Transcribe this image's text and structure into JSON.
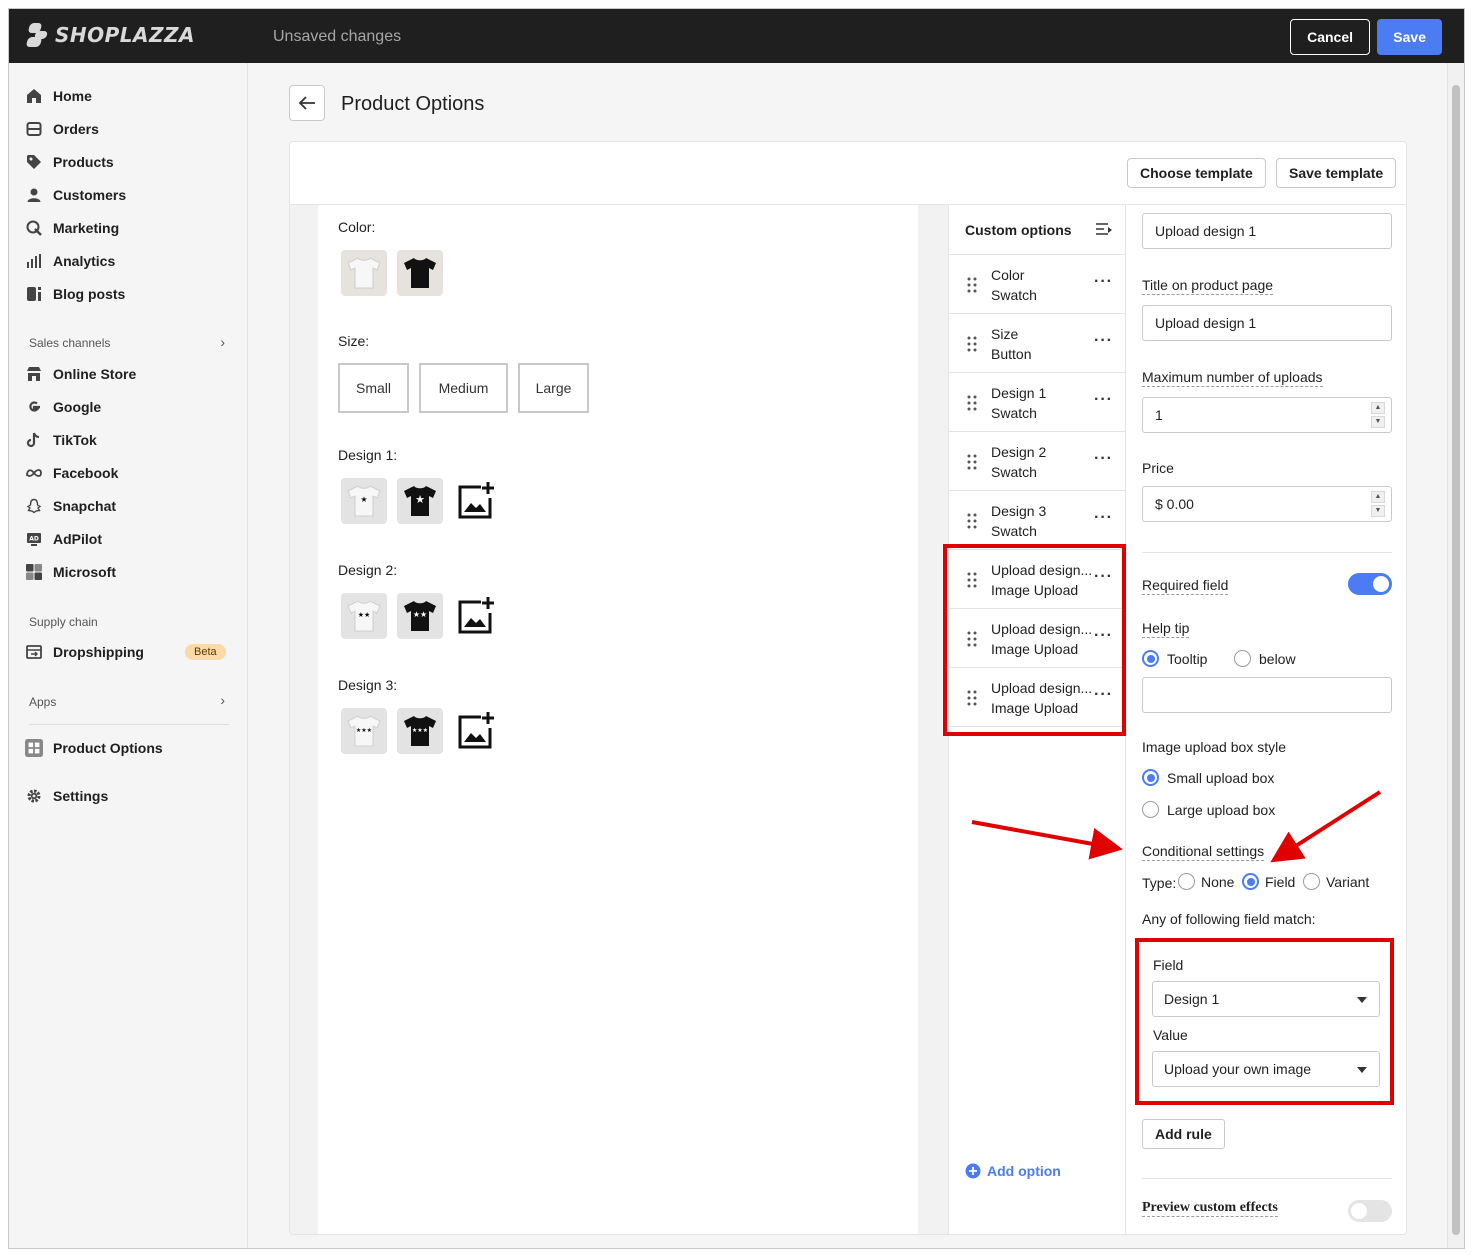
{
  "topbar": {
    "logo_text": "SHOPLAZZA",
    "status": "Unsaved changes",
    "cancel_label": "Cancel",
    "save_label": "Save",
    "accent": "#4c7cf3"
  },
  "sidebar": {
    "main_items": [
      {
        "label": "Home",
        "icon": "home-icon"
      },
      {
        "label": "Orders",
        "icon": "orders-icon"
      },
      {
        "label": "Products",
        "icon": "tag-icon"
      },
      {
        "label": "Customers",
        "icon": "person-icon"
      },
      {
        "label": "Marketing",
        "icon": "megaphone-icon"
      },
      {
        "label": "Analytics",
        "icon": "bar-chart-icon"
      },
      {
        "label": "Blog posts",
        "icon": "blog-icon"
      }
    ],
    "sales_channels_label": "Sales channels",
    "sales_channels": [
      {
        "label": "Online Store",
        "icon": "store-icon"
      },
      {
        "label": "Google",
        "icon": "google-icon"
      },
      {
        "label": "TikTok",
        "icon": "tiktok-icon"
      },
      {
        "label": "Facebook",
        "icon": "meta-icon"
      },
      {
        "label": "Snapchat",
        "icon": "ghost-icon"
      },
      {
        "label": "AdPilot",
        "icon": "ad-icon"
      },
      {
        "label": "Microsoft",
        "icon": "microsoft-icon"
      }
    ],
    "supply_chain_label": "Supply chain",
    "dropshipping_label": "Dropshipping",
    "beta_label": "Beta",
    "apps_label": "Apps",
    "product_options_label": "Product Options",
    "settings_label": "Settings"
  },
  "page": {
    "title": "Product Options",
    "choose_template": "Choose template",
    "save_template": "Save template"
  },
  "preview": {
    "color_label": "Color:",
    "size_label": "Size:",
    "sizes": [
      "Small",
      "Medium",
      "Large"
    ],
    "design1_label": "Design 1:",
    "design2_label": "Design 2:",
    "design3_label": "Design 3:"
  },
  "options": {
    "header": "Custom options",
    "rows": [
      {
        "title": "Color",
        "type": "Swatch"
      },
      {
        "title": "Size",
        "type": "Button"
      },
      {
        "title": "Design 1",
        "type": "Swatch"
      },
      {
        "title": "Design 2",
        "type": "Swatch"
      },
      {
        "title": "Design 3",
        "type": "Swatch"
      },
      {
        "title": "Upload design...",
        "type": "Image Upload"
      },
      {
        "title": "Upload design...",
        "type": "Image Upload"
      },
      {
        "title": "Upload design...",
        "type": "Image Upload"
      }
    ],
    "add_option": "Add option"
  },
  "settings": {
    "name_value": "Upload design 1",
    "title_label": "Title on product page",
    "title_value": "Upload design 1",
    "max_uploads_label": "Maximum number of uploads",
    "max_uploads_value": "1",
    "price_label": "Price",
    "price_value": "$ 0.00",
    "required_label": "Required field",
    "required_on": true,
    "help_tip_label": "Help tip",
    "help_tooltip": "Tooltip",
    "help_below": "below",
    "help_value": "",
    "box_style_label": "Image upload box style",
    "small_box": "Small upload box",
    "large_box": "Large upload box",
    "conditional_label": "Conditional settings",
    "type_label": "Type:",
    "type_none": "None",
    "type_field": "Field",
    "type_variant": "Variant",
    "match_label": "Any of following field match:",
    "field_label": "Field",
    "field_value": "Design 1",
    "value_label": "Value",
    "value_value": "Upload your own image",
    "add_rule": "Add rule",
    "preview_effects": "Preview custom effects",
    "preview_effects_on": false
  },
  "annotation_color": "#e00000"
}
